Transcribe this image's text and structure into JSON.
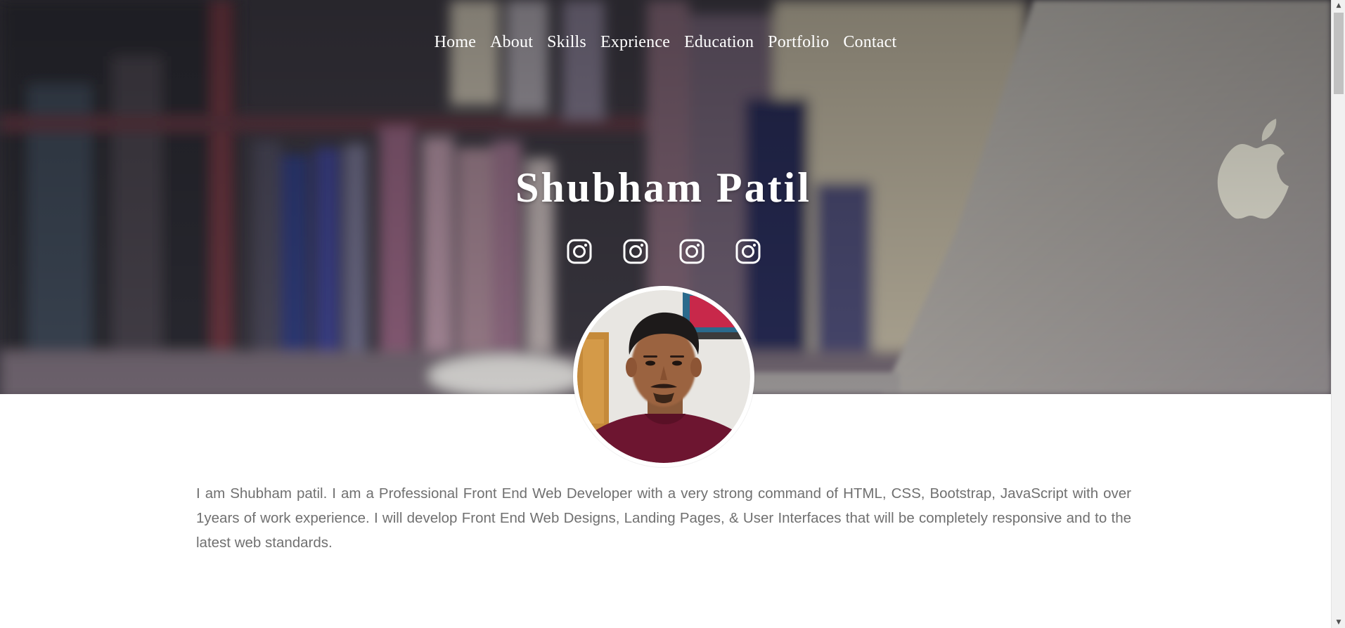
{
  "nav": {
    "items": [
      {
        "label": "Home"
      },
      {
        "label": "About"
      },
      {
        "label": "Skills"
      },
      {
        "label": "Exprience"
      },
      {
        "label": "Education"
      },
      {
        "label": "Portfolio"
      },
      {
        "label": "Contact"
      }
    ]
  },
  "hero": {
    "title": "Shubham Patil",
    "social_icons": [
      "instagram-icon",
      "instagram-icon",
      "instagram-icon",
      "instagram-icon"
    ]
  },
  "about": {
    "text": "I am Shubham patil. I am a Professional Front End Web Developer with a very strong command of HTML, CSS, Bootstrap, JavaScript with over 1years of work experience. I will develop Front End Web Designs, Landing Pages, & User Interfaces that will be completely responsive and to the latest web standards."
  },
  "colors": {
    "nav_text": "#ffffff",
    "title_text": "#ffffff",
    "body_text": "#707070",
    "background": "#ffffff"
  }
}
